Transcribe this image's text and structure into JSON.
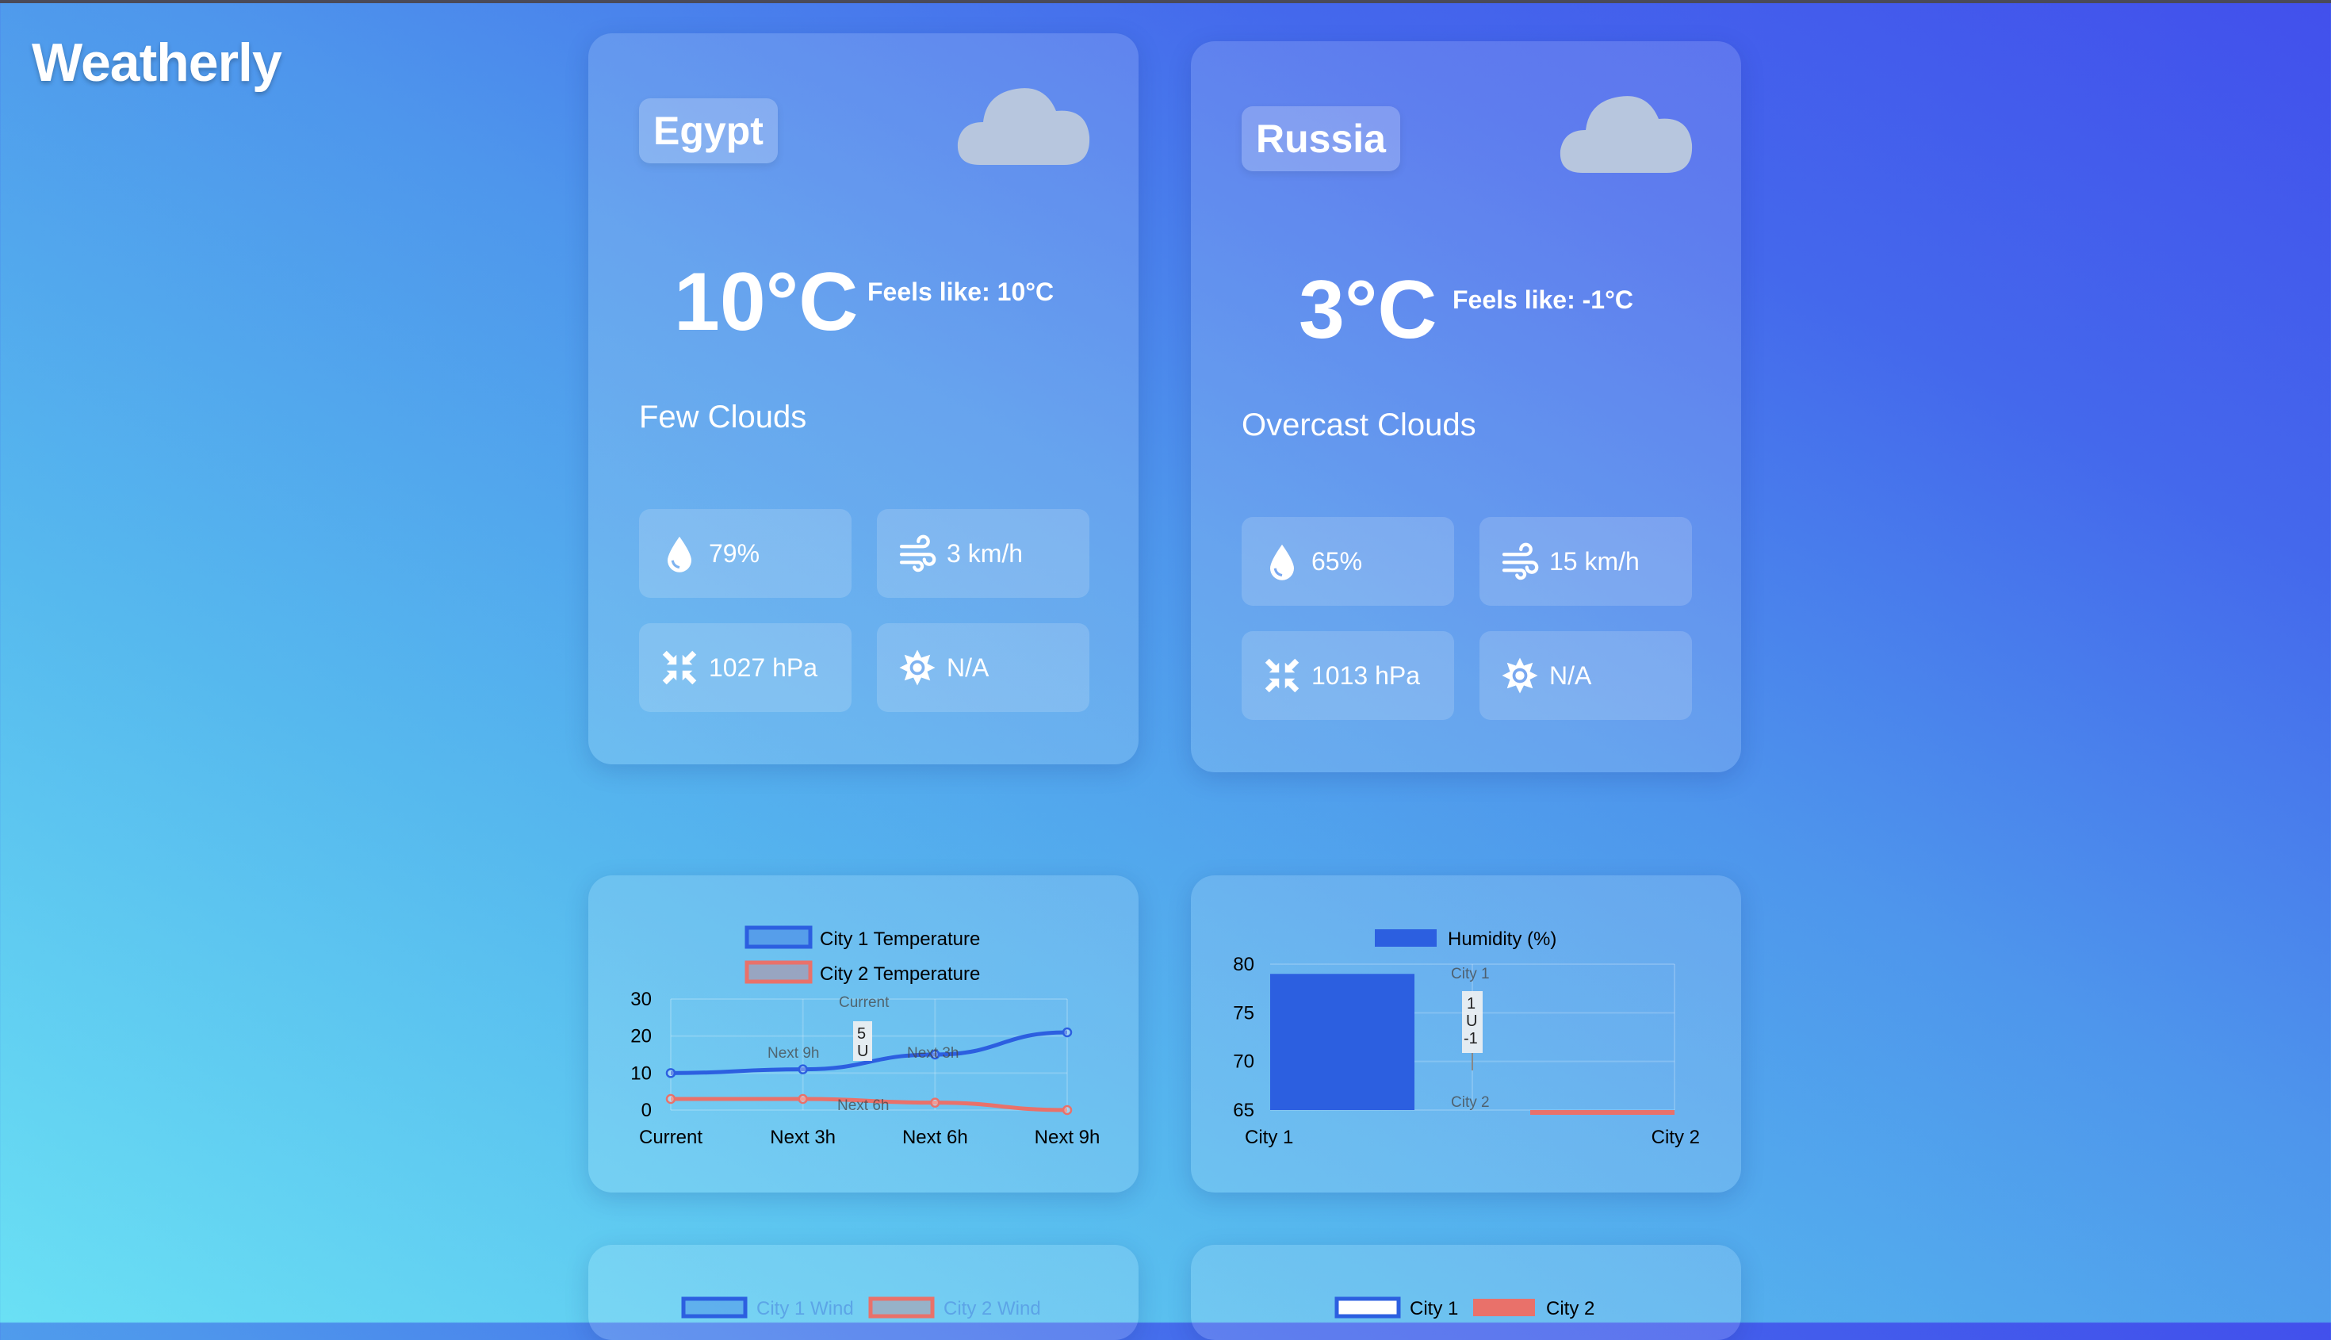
{
  "app": {
    "title": "Weatherly"
  },
  "cities": [
    {
      "country": "Egypt",
      "temperature": "10°C",
      "feels_like": "Feels like: 10°C",
      "description": "Few Clouds",
      "humidity": "79%",
      "wind": "3 km/h",
      "pressure": "1027 hPa",
      "uv": "N/A"
    },
    {
      "country": "Russia",
      "temperature": "3°C",
      "feels_like": "Feels like: -1°C",
      "description": "Overcast Clouds",
      "humidity": "65%",
      "wind": "15 km/h",
      "pressure": "1013 hPa",
      "uv": "N/A"
    }
  ],
  "icons": {
    "condition": "cloud-icon",
    "humidity": "water-drop-icon",
    "wind": "wind-icon",
    "pressure": "compress-arrows-icon",
    "uv": "sun-icon"
  },
  "colors": {
    "city1": "#2c5fe0",
    "city2": "#e9716a"
  },
  "chart_data": [
    {
      "type": "line",
      "categories": [
        "Current",
        "Next 3h",
        "Next 6h",
        "Next 9h"
      ],
      "series": [
        {
          "name": "City 1 Temperature",
          "values": [
            10,
            11,
            15,
            21
          ]
        },
        {
          "name": "City 2 Temperature",
          "values": [
            3,
            3,
            2,
            0
          ]
        }
      ],
      "yticks": [
        "0",
        "10",
        "20",
        "30"
      ],
      "ylim": [
        0,
        30
      ],
      "legend": "top",
      "grid": true,
      "overlay_labels": [
        "Current",
        "Next 9h",
        "Next 3h",
        "Next 6h",
        "5",
        "U"
      ]
    },
    {
      "type": "bar",
      "categories": [
        "City 1",
        "City 2"
      ],
      "series": [
        {
          "name": "Humidity (%)",
          "values": [
            79,
            65
          ]
        }
      ],
      "yticks": [
        "65",
        "70",
        "75",
        "80"
      ],
      "ylim": [
        65,
        80
      ],
      "legend": "top",
      "grid": true,
      "overlay_labels": [
        "City 1",
        "City 2",
        "1",
        "U",
        "-1"
      ]
    },
    {
      "type": "bar",
      "series": [
        {
          "name": "City 1 Wind"
        },
        {
          "name": "City 2 Wind"
        }
      ],
      "legend": "top"
    },
    {
      "type": "bar",
      "series": [
        {
          "name": "City 1"
        },
        {
          "name": "City 2"
        }
      ],
      "legend": "top"
    }
  ]
}
